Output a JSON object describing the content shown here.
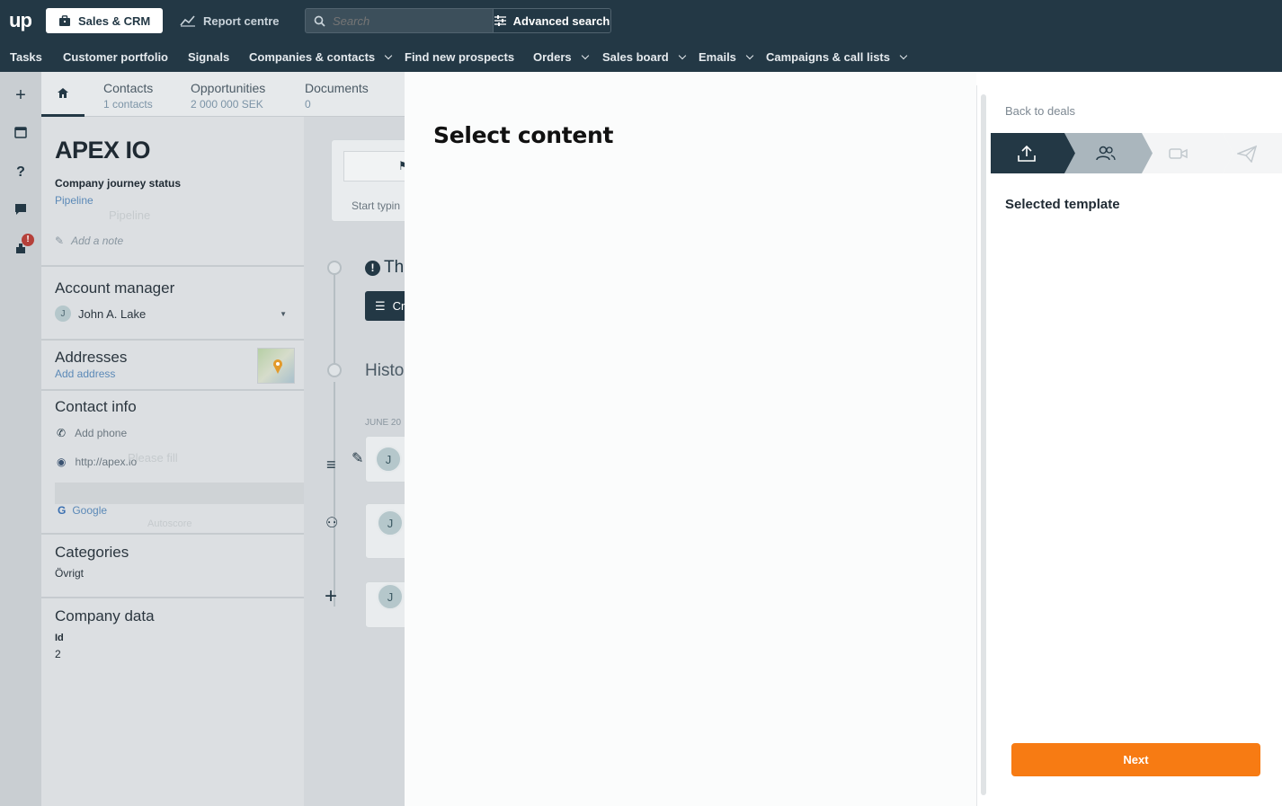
{
  "header": {
    "logo": "up",
    "sales_crm": "Sales & CRM",
    "report_centre": "Report centre",
    "search_placeholder": "Search",
    "advanced_search": "Advanced search"
  },
  "nav": {
    "items": [
      {
        "label": "Tasks",
        "dropdown": false
      },
      {
        "label": "Customer portfolio",
        "dropdown": false
      },
      {
        "label": "Signals",
        "dropdown": false
      },
      {
        "label": "Companies & contacts",
        "dropdown": true
      },
      {
        "label": "Find new prospects",
        "dropdown": false
      },
      {
        "label": "Orders",
        "dropdown": true
      },
      {
        "label": "Sales board",
        "dropdown": true
      },
      {
        "label": "Emails",
        "dropdown": true
      },
      {
        "label": "Campaigns & call lists",
        "dropdown": true
      }
    ]
  },
  "rail": {
    "icons": [
      "plus-icon",
      "calendar-icon",
      "help-icon",
      "chat-icon",
      "notifications-icon"
    ],
    "notification_badge": "!"
  },
  "company": {
    "tabs": [
      {
        "label": "Contacts",
        "sub": "1 contacts"
      },
      {
        "label": "Opportunities",
        "sub": "2 000 000 SEK"
      },
      {
        "label": "Documents",
        "sub": "0"
      }
    ],
    "name": "APEX IO",
    "journey_label": "Company journey status",
    "journey_value": "Pipeline",
    "journey_ghost": "Pipeline",
    "add_note": "Add a note",
    "account_manager_title": "Account manager",
    "account_manager_initial": "J",
    "account_manager_name": "John A. Lake",
    "addresses_title": "Addresses",
    "add_address": "Add address",
    "contact_info_title": "Contact info",
    "add_phone": "Add phone",
    "website": "http://apex.io",
    "website_ghost": "Please fill",
    "google": "Google",
    "google_ghost": "Autoscore",
    "categories_title": "Categories",
    "category_value": "Övrigt",
    "company_data_title": "Company data",
    "id_label": "Id",
    "id_value": "2"
  },
  "timeline": {
    "input_placeholder": "Start typin",
    "notice": "Th",
    "create_button": "Cr",
    "history": "Histo",
    "date_label": "JUNE 20",
    "avatar_initial": "J"
  },
  "modal": {
    "title": "Select content",
    "back": "Back to deals",
    "selected_template": "Selected template",
    "next": "Next",
    "steps": [
      "upload-icon",
      "users-icon",
      "video-icon",
      "send-icon"
    ]
  },
  "colors": {
    "header_bg": "#233845",
    "next_button": "#f77b13",
    "step_active": "#233845",
    "step_secondary": "#aab6bd",
    "link": "#5b89b7"
  }
}
